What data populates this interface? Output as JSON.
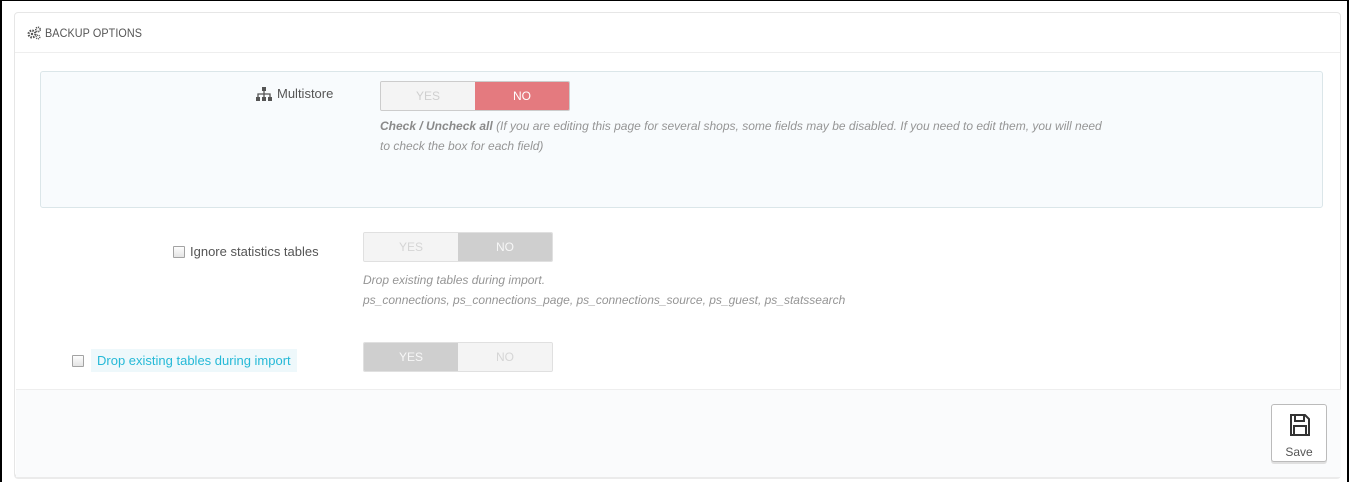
{
  "panel": {
    "heading_icon": "cogs-icon",
    "title": "BACKUP OPTIONS"
  },
  "multistore": {
    "icon": "sitemap-icon",
    "label": "Multistore",
    "yes_label": "YES",
    "no_label": "NO",
    "selected": "NO",
    "help_bold": "Check / Uncheck all",
    "help_line1": "(If you are editing this page for several shops, some fields may be disabled. If you need to edit them, you will need",
    "help_line2": "to check the box for each field)"
  },
  "fields": [
    {
      "label": "Ignore statistics tables",
      "yes_label": "YES",
      "no_label": "NO",
      "selected": "NO",
      "help_line1": "Drop existing tables during import.",
      "help_line2": "ps_connections, ps_connections_page, ps_connections_source, ps_guest, ps_statssearch"
    },
    {
      "label": "Drop existing tables during import",
      "yes_label": "YES",
      "no_label": "NO",
      "selected": "YES"
    }
  ],
  "footer": {
    "save_label": "Save",
    "save_icon": "floppy-disk-icon"
  },
  "colors": {
    "switch_no_active": "#e47a7f",
    "link_label": "#25b9d7"
  }
}
